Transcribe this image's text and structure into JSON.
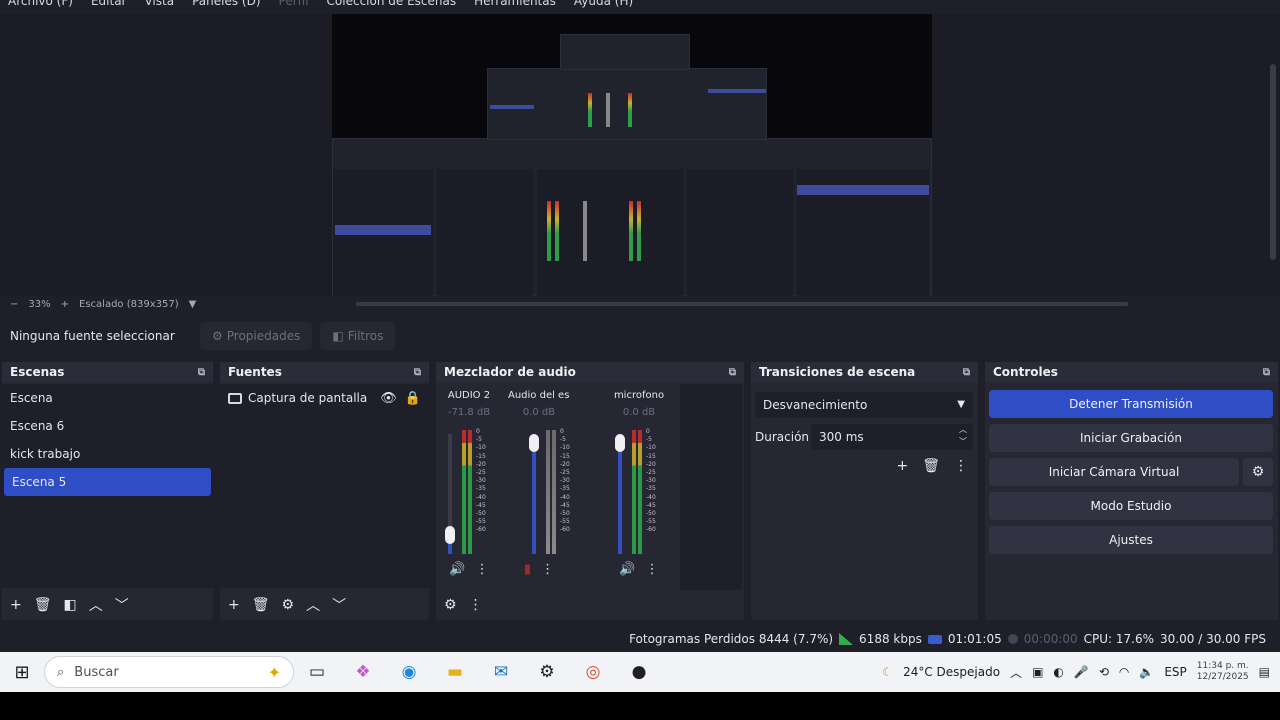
{
  "menu": [
    "Archivo (F)",
    "Editar",
    "Vista",
    "Paneles (D)",
    "Perfil",
    "Colección de Escenas",
    "Herramientas",
    "Ayuda (H)"
  ],
  "zoom": {
    "minus": "−",
    "level": "33%",
    "plus": "+",
    "scale_label": "Escalado (839x357)"
  },
  "source_toolbar": {
    "no_source": "Ninguna fuente seleccionar",
    "properties": "Propiedades",
    "filters": "Filtros"
  },
  "scenes": {
    "title": "Escenas",
    "items": [
      "Escena",
      "Escena 6",
      "kick trabajo",
      "Escena 5"
    ],
    "selected_index": 3
  },
  "sources": {
    "title": "Fuentes",
    "items": [
      {
        "name": "Captura de pantalla"
      }
    ]
  },
  "mixer": {
    "title": "Mezclador de audio",
    "channels": [
      {
        "name": "AUDIO 2",
        "db": "-71.8 dB",
        "level": 0.1,
        "muted": false
      },
      {
        "name": "Audio del escritorio",
        "db": "0.0 dB",
        "level": 1.0,
        "muted": true
      },
      {
        "name": "microfono",
        "db": "0.0 dB",
        "level": 1.0,
        "muted": false
      }
    ],
    "ticks": [
      "0",
      "-5",
      "-10",
      "-15",
      "-20",
      "-25",
      "-30",
      "-35",
      "-40",
      "-45",
      "-50",
      "-55",
      "-60"
    ]
  },
  "transitions": {
    "title": "Transiciones de escena",
    "selected": "Desvanecimiento",
    "duration_label": "Duración",
    "duration_value": "300 ms"
  },
  "controls": {
    "title": "Controles",
    "stop_stream": "Detener Transmisión",
    "start_recording": "Iniciar Grabación",
    "start_virtual_cam": "Iniciar Cámara Virtual",
    "studio_mode": "Modo Estudio",
    "settings": "Ajustes"
  },
  "status": {
    "dropped_frames": "Fotogramas Perdidos 8444 (7.7%)",
    "bitrate": "6188 kbps",
    "stream_time": "01:01:05",
    "rec_time": "00:00:00",
    "cpu": "CPU: 17.6%",
    "fps": "30.00 / 30.00 FPS"
  },
  "taskbar": {
    "search_placeholder": "Buscar",
    "weather": "24°C  Despejado",
    "lang": "ESP",
    "time": "11:34 p. m.",
    "date": "12/27/2025"
  },
  "colors": {
    "accent": "#2f4ec6",
    "panel": "#262733",
    "background": "#1e1f29",
    "meter_green": "#2b9a48"
  }
}
